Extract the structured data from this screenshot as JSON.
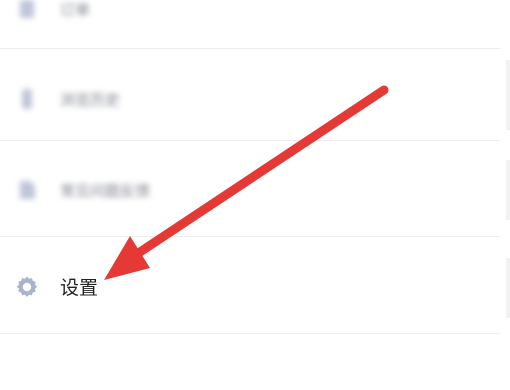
{
  "menu": {
    "items": [
      {
        "label": "订单",
        "icon": "order-icon",
        "blurred": true
      },
      {
        "label": "浏览历史",
        "icon": "history-icon",
        "blurred": true
      },
      {
        "label": "常见问题反馈",
        "icon": "feedback-icon",
        "blurred": true
      },
      {
        "label": "设置",
        "icon": "gear-icon",
        "blurred": false
      }
    ]
  },
  "annotation": {
    "arrow_color": "#e53935",
    "arrow_target": "settings"
  },
  "colors": {
    "icon": "#a9b3cc",
    "text": "#222222",
    "divider": "#eeeeee"
  }
}
